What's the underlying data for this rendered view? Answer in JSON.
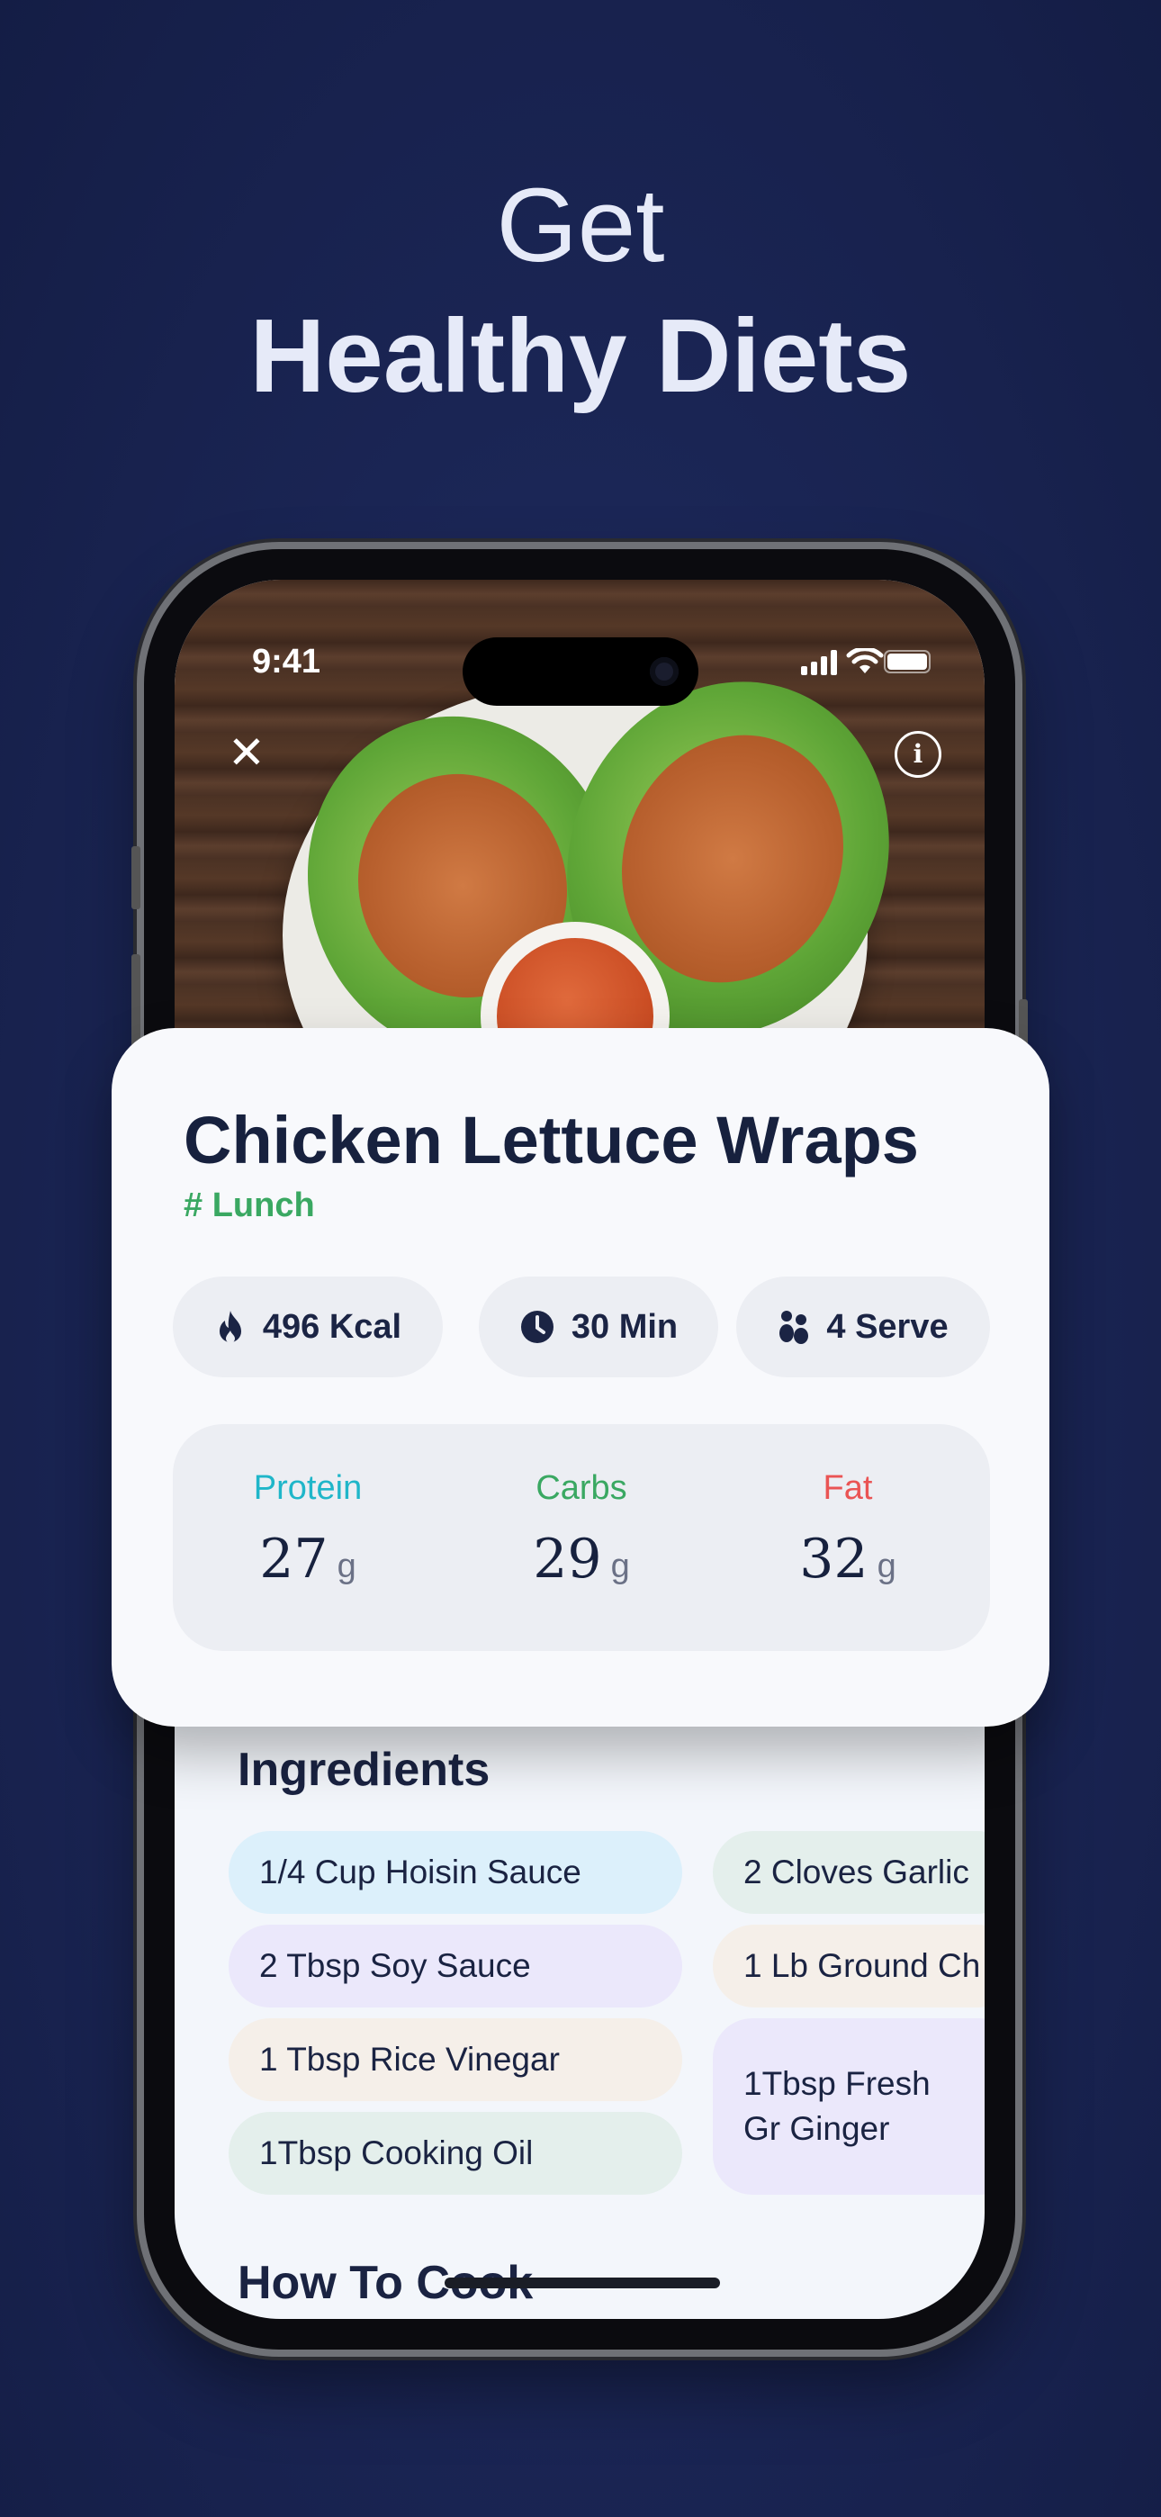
{
  "headline": {
    "line1": "Get",
    "line2": "Healthy Diets"
  },
  "status_bar": {
    "time": "9:41"
  },
  "recipe": {
    "title": "Chicken Lettuce Wraps",
    "tag": "# Lunch",
    "stats": [
      {
        "icon": "flame-icon",
        "label": "496 Kcal"
      },
      {
        "icon": "clock-icon",
        "label": "30 Min"
      },
      {
        "icon": "servings-icon",
        "label": "4 Serve"
      }
    ],
    "macros": [
      {
        "label": "Protein",
        "value": "27",
        "unit": "g",
        "color": "#1fb6c9"
      },
      {
        "label": "Carbs",
        "value": "29",
        "unit": "g",
        "color": "#3aa862"
      },
      {
        "label": "Fat",
        "value": "32",
        "unit": "g",
        "color": "#ea5454"
      }
    ]
  },
  "ingredients": {
    "title": "Ingredients",
    "items": [
      {
        "label": "1/4 Cup Hoisin Sauce",
        "bg": "#dcf0fb"
      },
      {
        "label": "2 Cloves Garlic",
        "bg": "#e4efec"
      },
      {
        "label": "2 Tbsp Soy Sauce",
        "bg": "#ebe8fb"
      },
      {
        "label": "1 Lb Ground Ch",
        "bg": "#f5efe9"
      },
      {
        "label": "1 Tbsp Rice Vinegar",
        "bg": "#f5efe9"
      },
      {
        "label": "1Tbsp Fresh Gr Ginger",
        "bg": "#ebe8fb"
      },
      {
        "label": "1Tbsp Cooking Oil",
        "bg": "#e4efec"
      }
    ]
  },
  "how_to_cook": {
    "title": "How To Cook"
  }
}
